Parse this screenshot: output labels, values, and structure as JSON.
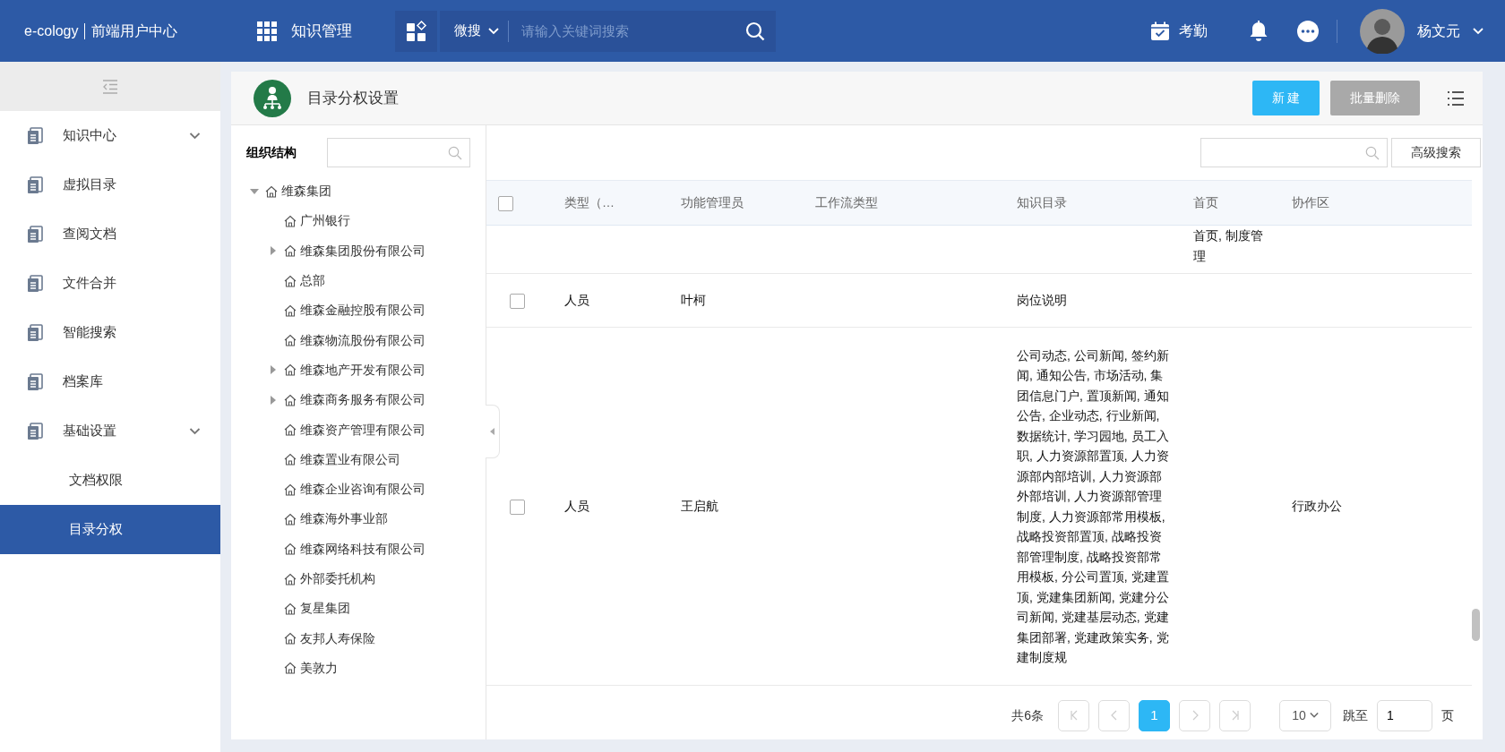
{
  "header": {
    "brand": "e-cology",
    "portal": "前端用户中心",
    "module": "知识管理",
    "search_scope": "微搜",
    "search_placeholder": "请输入关键词搜索",
    "attendance": "考勤",
    "user": "杨文元"
  },
  "sidebar": {
    "items": [
      {
        "label": "知识中心",
        "has_submenu": true,
        "selected": false
      },
      {
        "label": "虚拟目录",
        "has_submenu": false,
        "selected": false
      },
      {
        "label": "查阅文档",
        "has_submenu": false,
        "selected": false
      },
      {
        "label": "文件合并",
        "has_submenu": false,
        "selected": false
      },
      {
        "label": "智能搜索",
        "has_submenu": false,
        "selected": false
      },
      {
        "label": "档案库",
        "has_submenu": false,
        "selected": false
      },
      {
        "label": "基础设置",
        "has_submenu": true,
        "selected": false,
        "children": [
          {
            "label": "文档权限",
            "selected": false
          },
          {
            "label": "目录分权",
            "selected": true
          }
        ]
      }
    ]
  },
  "page": {
    "title": "目录分权设置",
    "buttons": [
      {
        "label": "新 建",
        "disabled": false
      },
      {
        "label": "批量删除",
        "disabled": true
      }
    ]
  },
  "org_tree": {
    "title": "组织结构",
    "nodes": [
      {
        "label": "维森集团",
        "expanded": true,
        "children": [
          {
            "label": "广州银行"
          },
          {
            "label": "维森集团股份有限公司",
            "expanded": false
          },
          {
            "label": "总部"
          },
          {
            "label": "维森金融控股有限公司"
          },
          {
            "label": "维森物流股份有限公司"
          },
          {
            "label": "维森地产开发有限公司",
            "expanded": false
          },
          {
            "label": "维森商务服务有限公司",
            "expanded": false
          },
          {
            "label": "维森资产管理有限公司"
          },
          {
            "label": "维森置业有限公司"
          },
          {
            "label": "维森企业咨询有限公司"
          },
          {
            "label": "维森海外事业部"
          },
          {
            "label": "维森网络科技有限公司"
          },
          {
            "label": "外部委托机构"
          },
          {
            "label": "复星集团"
          },
          {
            "label": "友邦人寿保险"
          },
          {
            "label": "美敦力"
          }
        ]
      }
    ]
  },
  "table": {
    "advanced_search": "高级搜索",
    "select_all": false,
    "columns": [
      "类型（…",
      "功能管理员",
      "工作流类型",
      "知识目录",
      "首页",
      "协作区"
    ],
    "rows": [
      {
        "cells": [
          "",
          "",
          "",
          "",
          "首页, 制度管理",
          ""
        ]
      },
      {
        "checked": false,
        "cells": [
          "人员",
          "叶柯",
          "",
          "岗位说明",
          "",
          ""
        ]
      },
      {
        "checked": false,
        "cells": [
          "人员",
          "王启航",
          "",
          "公司动态, 公司新闻, 签约新闻, 通知公告, 市场活动, 集团信息门户, 置顶新闻, 通知公告, 企业动态, 行业新闻, 数据统计, 学习园地, 员工入职, 人力资源部置顶, 人力资源部内部培训, 人力资源部外部培训, 人力资源部管理制度, 人力资源部常用模板, 战略投资部置顶, 战略投资部管理制度, 战略投资部常用模板, 分公司置顶, 党建置顶, 党建集团新闻, 党建分公司新闻, 党建基层动态, 党建集团部署, 党建政策实务, 党建制度规",
          "",
          "行政办公"
        ]
      }
    ]
  },
  "pagination": {
    "total": "共6条",
    "pages": [
      {
        "label": "1",
        "selected": true
      }
    ],
    "page_size": "10",
    "jump_label": "跳至",
    "jump_value": "1",
    "page_unit": "页"
  }
}
